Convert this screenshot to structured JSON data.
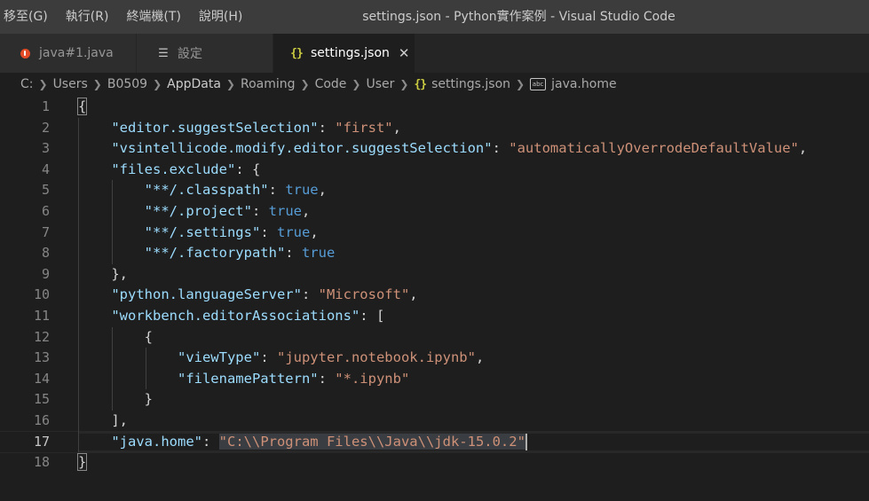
{
  "menu": [
    {
      "label": "移至(G)"
    },
    {
      "label": "執行(R)"
    },
    {
      "label": "終端機(T)"
    },
    {
      "label": "說明(H)"
    }
  ],
  "window_title": "settings.json - Python實作案例 - Visual Studio Code",
  "tabs": [
    {
      "label": "java#1.java",
      "icon": "java-icon",
      "active": false
    },
    {
      "label": "設定",
      "icon": "settings-editor-icon",
      "active": false
    },
    {
      "label": "settings.json",
      "icon": "json-braces-icon",
      "active": true
    }
  ],
  "breadcrumb": [
    "C:",
    "Users",
    "B0509",
    "AppData",
    "Roaming",
    "Code",
    "User",
    "settings.json",
    "java.home"
  ],
  "icons": {
    "key_badge": "abc"
  },
  "editor": {
    "line_numbers": [
      "1",
      "2",
      "3",
      "4",
      "5",
      "6",
      "7",
      "8",
      "9",
      "10",
      "11",
      "12",
      "13",
      "14",
      "15",
      "16",
      "17",
      "18"
    ],
    "current_line": 17,
    "lines": [
      "{",
      "    \"editor.suggestSelection\": \"first\",",
      "    \"vsintellicode.modify.editor.suggestSelection\": \"automaticallyOverrodeDefaultValue\",",
      "    \"files.exclude\": {",
      "        \"**/.classpath\": true,",
      "        \"**/.project\": true,",
      "        \"**/.settings\": true,",
      "        \"**/.factorypath\": true",
      "    },",
      "    \"python.languageServer\": \"Microsoft\",",
      "    \"workbench.editorAssociations\": [",
      "        {",
      "            \"viewType\": \"jupyter.notebook.ipynb\",",
      "            \"filenamePattern\": \"*.ipynb\"",
      "        }",
      "    ],",
      "    \"java.home\": \"C:\\\\Program Files\\\\Java\\\\jdk-15.0.2\"",
      "}"
    ]
  },
  "colors": {
    "key": "#9cdcfe",
    "string": "#ce9178",
    "boolean": "#569cd6",
    "punctuation": "#d4d4d4",
    "json_icon": "#cbcb41",
    "java_icon": "#e34c26"
  }
}
